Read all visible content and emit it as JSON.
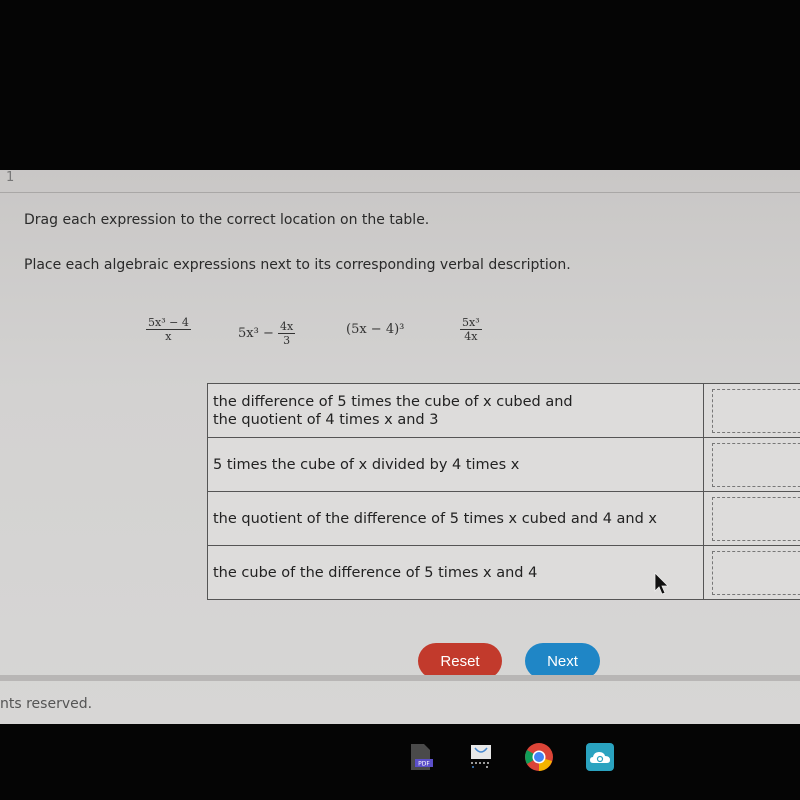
{
  "question": {
    "number": "1",
    "instruction_1": "Drag each expression to the correct location on the table.",
    "instruction_2": "Place each algebraic expressions next to its corresponding verbal description."
  },
  "expressions": [
    {
      "id": "expr-1",
      "numerator": "5x³ − 4",
      "denominator": "x"
    },
    {
      "id": "expr-2",
      "lead": "5x³ − ",
      "numerator": "4x",
      "denominator": "3"
    },
    {
      "id": "expr-3",
      "text": "(5x − 4)³"
    },
    {
      "id": "expr-4",
      "numerator": "5x³",
      "denominator": "4x"
    }
  ],
  "table": {
    "rows": [
      {
        "description": "the difference of 5 times the cube of x cubed and the quotient of 4 times x and 3",
        "line1": "the difference of 5 times the cube of x cubed and",
        "line2": "the quotient of 4 times x and 3",
        "answer": ""
      },
      {
        "description": "5 times the cube of x divided by 4 times x",
        "answer": ""
      },
      {
        "description": "the quotient of the difference of 5 times x cubed and 4 and x",
        "answer": ""
      },
      {
        "description": "the cube of the difference of 5 times x and 4",
        "answer": ""
      }
    ]
  },
  "buttons": {
    "reset": "Reset",
    "next": "Next"
  },
  "footer": "nts reserved.",
  "colors": {
    "reset": "#c23a2c",
    "next": "#1f86c6"
  },
  "taskbar": {
    "icons": [
      "pdf-icon",
      "screencast-icon",
      "chrome-icon",
      "cloud-app-icon"
    ],
    "pdf_label": "PDF"
  }
}
